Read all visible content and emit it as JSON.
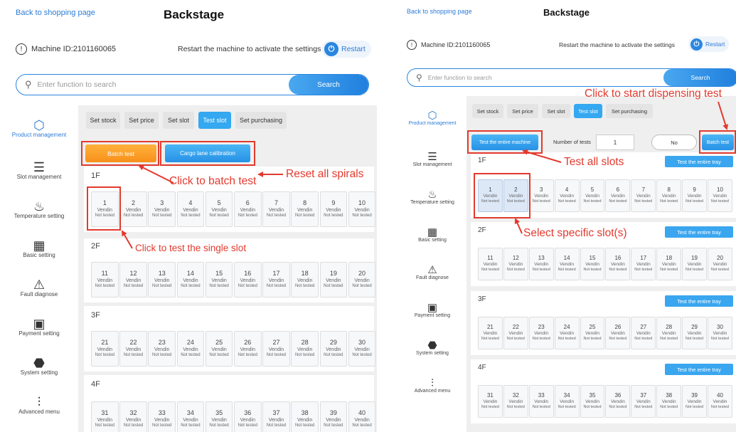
{
  "left": {
    "back": "Back to shopping page",
    "title": "Backstage",
    "machine_id": "Machine ID:2101160065",
    "restart_msg": "Restart the machine to activate the settings",
    "restart_btn": "Restart",
    "search_placeholder": "Enter function to search",
    "search_btn": "Search",
    "tabs": [
      "Set stock",
      "Set price",
      "Set slot",
      "Test slot",
      "Set purchasing"
    ],
    "batch_test": "Batch test",
    "calibration": "Cargo lane calibration",
    "floors": [
      {
        "label": "1F",
        "slots": [
          {
            "n": "1",
            "v": "Vendin",
            "s": "Not tested"
          },
          {
            "n": "2",
            "v": "Vendin",
            "s": "Not tested"
          },
          {
            "n": "3",
            "v": "Vendin",
            "s": "Not tested"
          },
          {
            "n": "4",
            "v": "Vendin",
            "s": "Not tested"
          },
          {
            "n": "5",
            "v": "Vendin",
            "s": "Not tested"
          },
          {
            "n": "6",
            "v": "Vendin",
            "s": "Not tested"
          },
          {
            "n": "7",
            "v": "Vendin",
            "s": "Not tested"
          },
          {
            "n": "8",
            "v": "Vendin",
            "s": "Not tested"
          },
          {
            "n": "9",
            "v": "Vendin",
            "s": "Not tested"
          },
          {
            "n": "10",
            "v": "Vendin",
            "s": "Not tested"
          }
        ]
      },
      {
        "label": "2F",
        "slots": [
          {
            "n": "11",
            "v": "Vendin",
            "s": "Not tested"
          },
          {
            "n": "12",
            "v": "Vendin",
            "s": "Not tested"
          },
          {
            "n": "13",
            "v": "Vendin",
            "s": "Not tested"
          },
          {
            "n": "14",
            "v": "Vendin",
            "s": "Not tested"
          },
          {
            "n": "15",
            "v": "Vendin",
            "s": "Not tested"
          },
          {
            "n": "16",
            "v": "Vendin",
            "s": "Not tested"
          },
          {
            "n": "17",
            "v": "Vendin",
            "s": "Not tested"
          },
          {
            "n": "18",
            "v": "Vendin",
            "s": "Not tested"
          },
          {
            "n": "19",
            "v": "Vendin",
            "s": "Not tested"
          },
          {
            "n": "20",
            "v": "Vendin",
            "s": "Not tested"
          }
        ]
      },
      {
        "label": "3F",
        "slots": [
          {
            "n": "21",
            "v": "Vendin",
            "s": "Not tested"
          },
          {
            "n": "22",
            "v": "Vendin",
            "s": "Not tested"
          },
          {
            "n": "23",
            "v": "Vendin",
            "s": "Not tested"
          },
          {
            "n": "24",
            "v": "Vendin",
            "s": "Not tested"
          },
          {
            "n": "25",
            "v": "Vendin",
            "s": "Not tested"
          },
          {
            "n": "26",
            "v": "Vendin",
            "s": "Not tested"
          },
          {
            "n": "27",
            "v": "Vendin",
            "s": "Not tested"
          },
          {
            "n": "28",
            "v": "Vendin",
            "s": "Not tested"
          },
          {
            "n": "29",
            "v": "Vendin",
            "s": "Not tested"
          },
          {
            "n": "30",
            "v": "Vendin",
            "s": "Not tested"
          }
        ]
      },
      {
        "label": "4F",
        "slots": [
          {
            "n": "31",
            "v": "Vendin",
            "s": "Not tested"
          },
          {
            "n": "32",
            "v": "Vendin",
            "s": "Not tested"
          },
          {
            "n": "33",
            "v": "Vendin",
            "s": "Not tested"
          },
          {
            "n": "34",
            "v": "Vendin",
            "s": "Not tested"
          },
          {
            "n": "35",
            "v": "Vendin",
            "s": "Not tested"
          },
          {
            "n": "36",
            "v": "Vendin",
            "s": "Not tested"
          },
          {
            "n": "37",
            "v": "Vendin",
            "s": "Not tested"
          },
          {
            "n": "38",
            "v": "Vendin",
            "s": "Not tested"
          },
          {
            "n": "39",
            "v": "Vendin",
            "s": "Not tested"
          },
          {
            "n": "40",
            "v": "Vendin",
            "s": "Not tested"
          }
        ]
      }
    ],
    "annotations": {
      "reset": "Reset all spirals",
      "batch": "Click to batch test",
      "single": "Click to test the single slot"
    }
  },
  "right": {
    "back": "Back to shopping page",
    "title": "Backstage",
    "machine_id": "Machine ID:2101160065",
    "restart_msg": "Restart the machine to activate the settings",
    "restart_btn": "Restart",
    "search_placeholder": "Enter function to search",
    "search_btn": "Search",
    "tabs": [
      "Set stock",
      "Set price",
      "Set slot",
      "Test slot",
      "Set purchasing"
    ],
    "test_entire_machine": "Test the entire machine",
    "number_of_tests_label": "Number of tests",
    "number_of_tests_value": "1",
    "no_btn": "No",
    "batch_test": "Batch test",
    "tray_btn": "Test the entire tray",
    "floors": [
      {
        "label": "1F",
        "slots": [
          {
            "n": "1",
            "v": "Vendin",
            "s": "Not tested"
          },
          {
            "n": "2",
            "v": "Vendin",
            "s": "Not tested"
          },
          {
            "n": "3",
            "v": "Vendin",
            "s": "Not tested"
          },
          {
            "n": "4",
            "v": "Vendin",
            "s": "Not tested"
          },
          {
            "n": "5",
            "v": "Vendin",
            "s": "Not tested"
          },
          {
            "n": "6",
            "v": "Vendin",
            "s": "Not tested"
          },
          {
            "n": "7",
            "v": "Vendin",
            "s": "Not tested"
          },
          {
            "n": "8",
            "v": "Vendin",
            "s": "Not tested"
          },
          {
            "n": "9",
            "v": "Vendin",
            "s": "Not tested"
          },
          {
            "n": "10",
            "v": "Vendin",
            "s": "Not tested"
          }
        ]
      },
      {
        "label": "2F",
        "slots": [
          {
            "n": "11",
            "v": "Vendin",
            "s": "Not tested"
          },
          {
            "n": "12",
            "v": "Vendin",
            "s": "Not tested"
          },
          {
            "n": "13",
            "v": "Vendin",
            "s": "Not tested"
          },
          {
            "n": "14",
            "v": "Vendin",
            "s": "Not tested"
          },
          {
            "n": "15",
            "v": "Vendin",
            "s": "Not tested"
          },
          {
            "n": "16",
            "v": "Vendin",
            "s": "Not tested"
          },
          {
            "n": "17",
            "v": "Vendin",
            "s": "Not tested"
          },
          {
            "n": "18",
            "v": "Vendin",
            "s": "Not tested"
          },
          {
            "n": "19",
            "v": "Vendin",
            "s": "Not tested"
          },
          {
            "n": "20",
            "v": "Vendin",
            "s": "Not tested"
          }
        ]
      },
      {
        "label": "3F",
        "slots": [
          {
            "n": "21",
            "v": "Vendin",
            "s": "Not tested"
          },
          {
            "n": "22",
            "v": "Vendin",
            "s": "Not tested"
          },
          {
            "n": "23",
            "v": "Vendin",
            "s": "Not tested"
          },
          {
            "n": "24",
            "v": "Vendin",
            "s": "Not tested"
          },
          {
            "n": "25",
            "v": "Vendin",
            "s": "Not tested"
          },
          {
            "n": "26",
            "v": "Vendin",
            "s": "Not tested"
          },
          {
            "n": "27",
            "v": "Vendin",
            "s": "Not tested"
          },
          {
            "n": "28",
            "v": "Vendin",
            "s": "Not tested"
          },
          {
            "n": "29",
            "v": "Vendin",
            "s": "Not tested"
          },
          {
            "n": "30",
            "v": "Vendin",
            "s": "Not tested"
          }
        ]
      },
      {
        "label": "4F",
        "slots": [
          {
            "n": "31",
            "v": "Vendin",
            "s": "Not tested"
          },
          {
            "n": "32",
            "v": "Vendin",
            "s": "Not tested"
          },
          {
            "n": "33",
            "v": "Vendin",
            "s": "Not tested"
          },
          {
            "n": "34",
            "v": "Vendin",
            "s": "Not tested"
          },
          {
            "n": "35",
            "v": "Vendin",
            "s": "Not tested"
          },
          {
            "n": "36",
            "v": "Vendin",
            "s": "Not tested"
          },
          {
            "n": "37",
            "v": "Vendin",
            "s": "Not tested"
          },
          {
            "n": "38",
            "v": "Vendin",
            "s": "Not tested"
          },
          {
            "n": "39",
            "v": "Vendin",
            "s": "Not tested"
          },
          {
            "n": "40",
            "v": "Vendin",
            "s": "Not tested"
          }
        ]
      }
    ],
    "annotations": {
      "dispense": "Click to start dispensing test",
      "all_slots": "Test all slots",
      "specific": "Select specific slot(s)"
    }
  },
  "sidebar": [
    {
      "icon": "cube-icon",
      "label": "Product management"
    },
    {
      "icon": "slot-management-icon",
      "label": "Slot management"
    },
    {
      "icon": "temperature-icon",
      "label": "Temperature setting"
    },
    {
      "icon": "grid-icon",
      "label": "Basic setting"
    },
    {
      "icon": "warning-icon",
      "label": "Fault diagnose"
    },
    {
      "icon": "wallet-icon",
      "label": "Payment setting"
    },
    {
      "icon": "system-icon",
      "label": "System setting"
    },
    {
      "icon": "advanced-menu-icon",
      "label": "Advanced menu"
    }
  ],
  "colors": {
    "accent": "#2a86e0",
    "tab_active": "#34a8f0",
    "batch_orange": "#f8901a",
    "annotation_red": "#e23a2e"
  }
}
